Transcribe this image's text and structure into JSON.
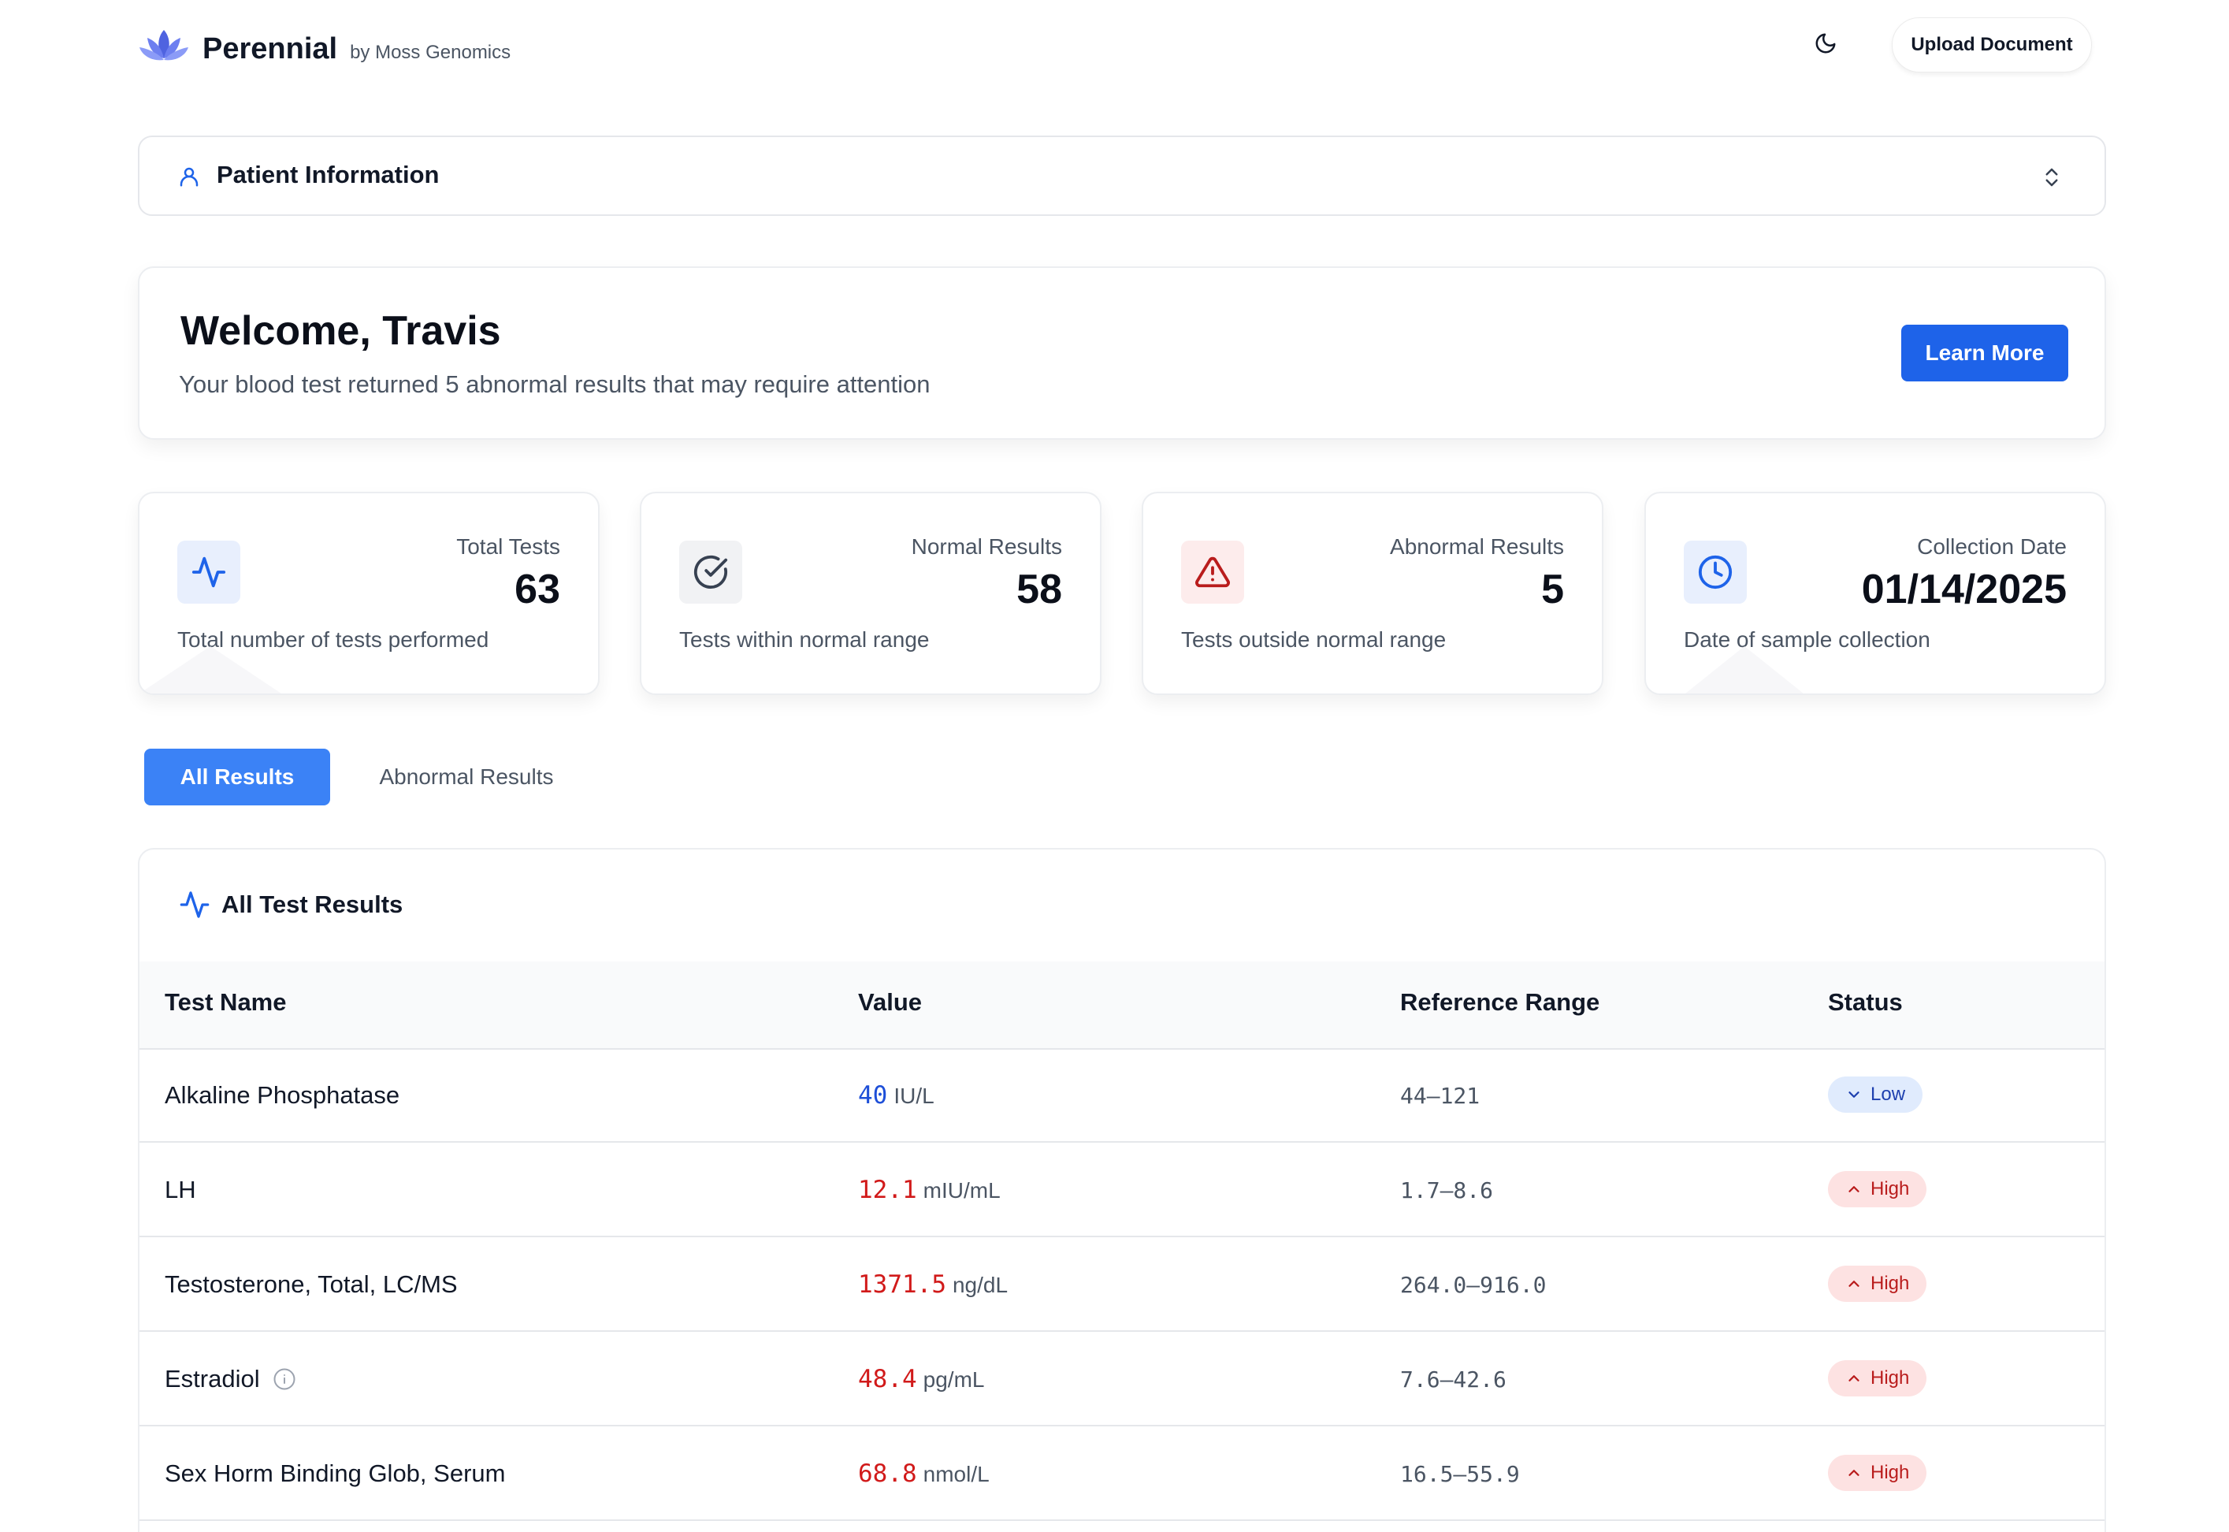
{
  "header": {
    "brand_name": "Perennial",
    "brand_by": "by Moss Genomics",
    "upload_label": "Upload Document"
  },
  "patient": {
    "title": "Patient Information"
  },
  "welcome": {
    "title": "Welcome, Travis",
    "subtitle": "Your blood test returned 5 abnormal results that may require attention",
    "button_label": "Learn More"
  },
  "stats": [
    {
      "label": "Total Tests",
      "value": "63",
      "desc": "Total number of tests performed",
      "icon": "activity-icon",
      "icon_color": "#1e63e9",
      "icon_bg": "#e8effd"
    },
    {
      "label": "Normal Results",
      "value": "58",
      "desc": "Tests within normal range",
      "icon": "check-circle-icon",
      "icon_color": "#374151",
      "icon_bg": "#f1f2f4"
    },
    {
      "label": "Abnormal Results",
      "value": "5",
      "desc": "Tests outside normal range",
      "icon": "alert-triangle-icon",
      "icon_color": "#b91c1c",
      "icon_bg": "#fdecec"
    },
    {
      "label": "Collection Date",
      "value": "01/14/2025",
      "desc": "Date of sample collection",
      "icon": "clock-icon",
      "icon_color": "#1e63e9",
      "icon_bg": "#e8effd"
    }
  ],
  "tabs": {
    "all_label": "All Results",
    "abnormal_label": "Abnormal Results"
  },
  "results": {
    "title": "All Test Results",
    "columns": [
      "Test Name",
      "Value",
      "Reference Range",
      "Status"
    ],
    "rows": [
      {
        "name": "Alkaline Phosphatase",
        "value": "40",
        "unit": "IU/L",
        "range": "44–121",
        "status": "Low",
        "value_color": "#1e4fd8"
      },
      {
        "name": "LH",
        "value": "12.1",
        "unit": "mIU/mL",
        "range": "1.7–8.6",
        "status": "High",
        "value_color": "#d11a1a"
      },
      {
        "name": "Testosterone, Total, LC/MS",
        "value": "1371.5",
        "unit": "ng/dL",
        "range": "264.0–916.0",
        "status": "High",
        "value_color": "#d11a1a"
      },
      {
        "name": "Estradiol",
        "value": "48.4",
        "unit": "pg/mL",
        "range": "7.6–42.6",
        "status": "High",
        "value_color": "#d11a1a"
      },
      {
        "name": "Sex Horm Binding Glob, Serum",
        "value": "68.8",
        "unit": "nmol/L",
        "range": "16.5–55.9",
        "status": "High",
        "value_color": "#d11a1a"
      }
    ]
  },
  "colors": {
    "accent": "#1e63e9",
    "tab_active": "#3b82f6",
    "low": "#1e40af",
    "high": "#b91c1c"
  }
}
